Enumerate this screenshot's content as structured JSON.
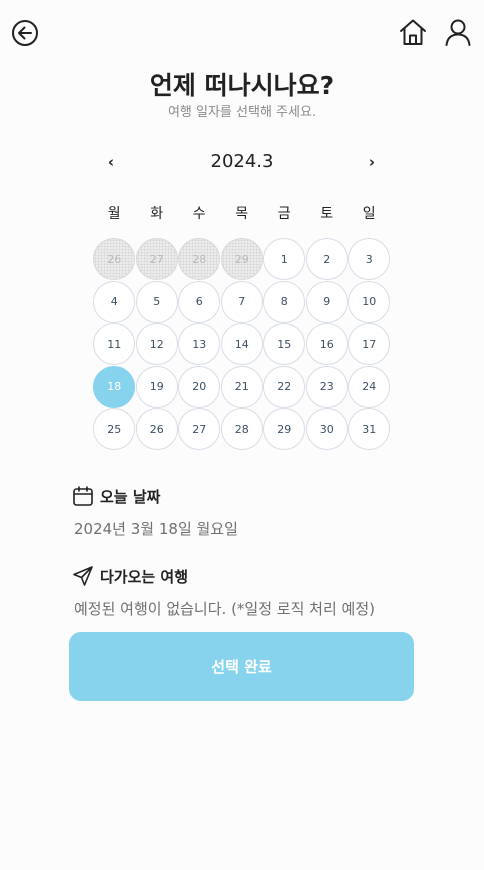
{
  "header": {
    "back_icon": "arrow-left-circle-icon",
    "home_icon": "home-icon",
    "user_icon": "user-icon"
  },
  "title": "언제 떠나시나요?",
  "subtitle": "여행 일자를 선택해 주세요.",
  "calendar": {
    "prev": "‹",
    "next": "›",
    "month_label": "2024.3",
    "weekdays": [
      "월",
      "화",
      "수",
      "목",
      "금",
      "토",
      "일"
    ],
    "days": [
      {
        "label": "26",
        "state": "disabled"
      },
      {
        "label": "27",
        "state": "disabled"
      },
      {
        "label": "28",
        "state": "disabled"
      },
      {
        "label": "29",
        "state": "disabled"
      },
      {
        "label": "1",
        "state": "normal"
      },
      {
        "label": "2",
        "state": "normal"
      },
      {
        "label": "3",
        "state": "normal"
      },
      {
        "label": "4",
        "state": "normal"
      },
      {
        "label": "5",
        "state": "normal"
      },
      {
        "label": "6",
        "state": "normal"
      },
      {
        "label": "7",
        "state": "normal"
      },
      {
        "label": "8",
        "state": "normal"
      },
      {
        "label": "9",
        "state": "normal"
      },
      {
        "label": "10",
        "state": "normal"
      },
      {
        "label": "11",
        "state": "normal"
      },
      {
        "label": "12",
        "state": "normal"
      },
      {
        "label": "13",
        "state": "normal"
      },
      {
        "label": "14",
        "state": "normal"
      },
      {
        "label": "15",
        "state": "normal"
      },
      {
        "label": "16",
        "state": "normal"
      },
      {
        "label": "17",
        "state": "normal"
      },
      {
        "label": "18",
        "state": "selected"
      },
      {
        "label": "19",
        "state": "normal"
      },
      {
        "label": "20",
        "state": "normal"
      },
      {
        "label": "21",
        "state": "normal"
      },
      {
        "label": "22",
        "state": "normal"
      },
      {
        "label": "23",
        "state": "normal"
      },
      {
        "label": "24",
        "state": "normal"
      },
      {
        "label": "25",
        "state": "normal"
      },
      {
        "label": "26",
        "state": "normal"
      },
      {
        "label": "27",
        "state": "normal"
      },
      {
        "label": "28",
        "state": "normal"
      },
      {
        "label": "29",
        "state": "normal"
      },
      {
        "label": "30",
        "state": "normal"
      },
      {
        "label": "31",
        "state": "normal"
      }
    ]
  },
  "today": {
    "icon": "calendar-icon",
    "label": "오늘 날짜",
    "value": "2024년 3월 18일 월요일"
  },
  "upcoming": {
    "icon": "send-icon",
    "label": "다가오는 여행",
    "value": "예정된 여행이 없습니다. (*일정 로직 처리 예정)"
  },
  "confirm_button": "선택 완료",
  "colors": {
    "accent": "#87d3ee",
    "text": "#222222",
    "muted": "#8a8a8a",
    "day_text": "#3a4f66"
  }
}
